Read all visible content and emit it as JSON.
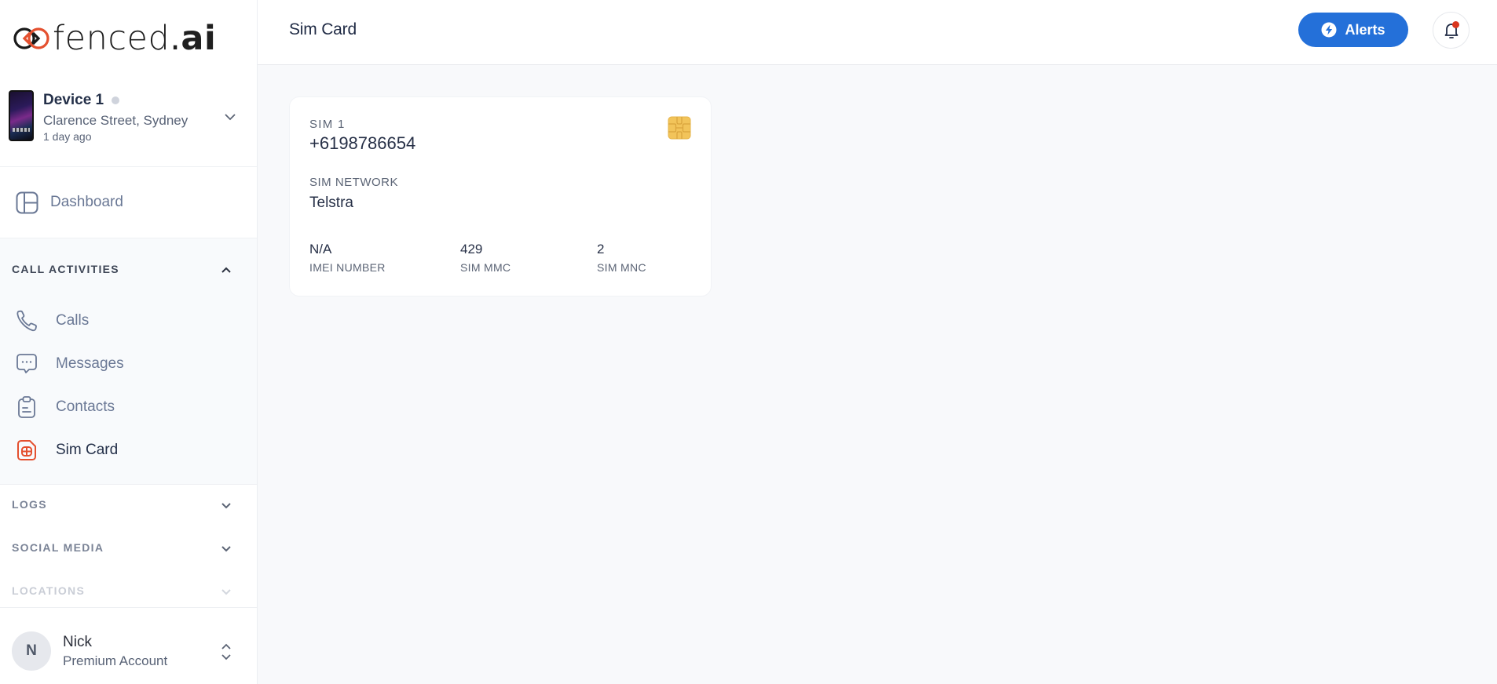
{
  "brand": {
    "name_main": "fenced",
    "name_dot": ".",
    "name_suffix": "ai",
    "accent": "#e4502f"
  },
  "device": {
    "name": "Device 1",
    "location": "Clarence Street, Sydney",
    "last_seen": "1 day ago",
    "status": "offline"
  },
  "sidebar": {
    "dashboard_label": "Dashboard",
    "sections": [
      {
        "title": "CALL ACTIVITIES",
        "expanded": true,
        "items": [
          {
            "label": "Calls",
            "icon": "phone-icon"
          },
          {
            "label": "Messages",
            "icon": "message-icon"
          },
          {
            "label": "Contacts",
            "icon": "clipboard-icon"
          },
          {
            "label": "Sim Card",
            "icon": "sim-card-icon",
            "active": true
          }
        ]
      },
      {
        "title": "LOGS",
        "expanded": false
      },
      {
        "title": "SOCIAL MEDIA",
        "expanded": false
      },
      {
        "title": "LOCATIONS",
        "expanded": false
      }
    ],
    "user": {
      "initial": "N",
      "name": "Nick",
      "plan": "Premium Account"
    }
  },
  "header": {
    "title": "Sim Card",
    "alerts_label": "Alerts",
    "has_notifications": true,
    "primary_color": "#2470d9"
  },
  "sim": {
    "slot_label": "SIM 1",
    "phone_number": "+6198786654",
    "network_label": "SIM NETWORK",
    "network_value": "Telstra",
    "stats": [
      {
        "value": "N/A",
        "label": "IMEI NUMBER"
      },
      {
        "value": "429",
        "label": "SIM MMC"
      },
      {
        "value": "2",
        "label": "SIM MNC"
      }
    ]
  }
}
